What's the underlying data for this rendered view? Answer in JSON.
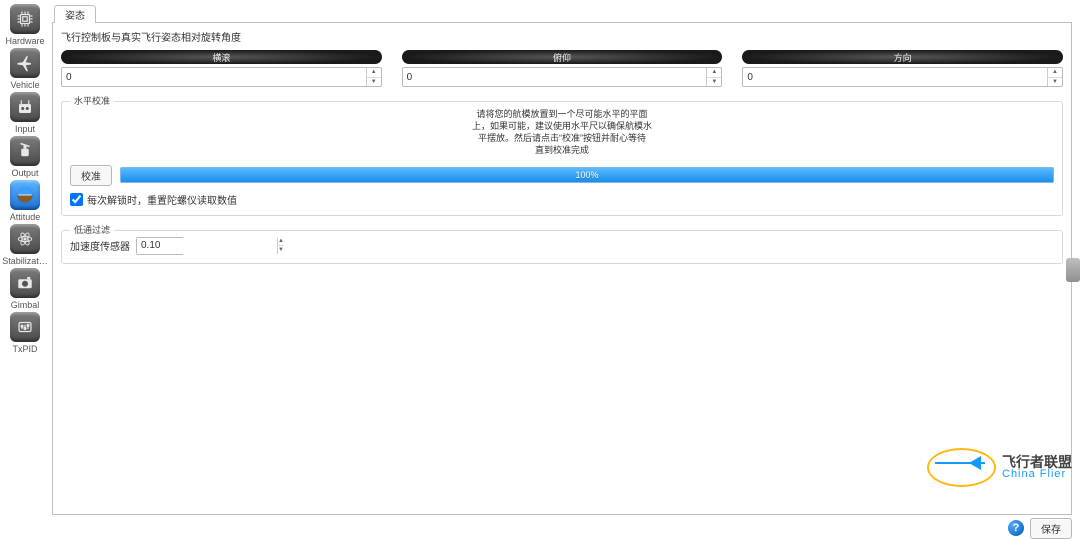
{
  "tabs": {
    "attitude": "姿态"
  },
  "sections": {
    "rotation": "飞行控制板与真实飞行姿态相对旋转角度",
    "level": "水平校准",
    "lowpass": "低通过滤"
  },
  "trims": {
    "roll": {
      "label": "横滚",
      "value": "0"
    },
    "pitch": {
      "label": "俯仰",
      "value": "0"
    },
    "yaw": {
      "label": "方向",
      "value": "0"
    }
  },
  "level_instructions": [
    "请将您的航模放置到一个尽可能水平的平面",
    "上，如果可能，建议使用水平尺以确保航模水",
    "平摆放。然后请点击“校准”按钮并耐心等待",
    "直到校准完成"
  ],
  "level": {
    "calibrate_label": "校准",
    "progress_text": "100%",
    "checkbox_label": "每次解锁时，重置陀螺仪读取数值",
    "checkbox_checked": true
  },
  "lowpass": {
    "accel_label": "加速度传感器",
    "value": "0.10"
  },
  "footer": {
    "help": "?",
    "save": "保存"
  },
  "watermark": {
    "line1": "飞行者联盟",
    "line2": "China Flier"
  },
  "sidebar": {
    "items": [
      {
        "key": "hardware",
        "label": "Hardware"
      },
      {
        "key": "vehicle",
        "label": "Vehicle"
      },
      {
        "key": "input",
        "label": "Input"
      },
      {
        "key": "output",
        "label": "Output"
      },
      {
        "key": "attitude",
        "label": "Attitude",
        "active": true
      },
      {
        "key": "stabiliz",
        "label": "Stabilizat…"
      },
      {
        "key": "gimbal",
        "label": "Gimbal"
      },
      {
        "key": "txpid",
        "label": "TxPID"
      }
    ]
  },
  "chart_data": {
    "type": "progress",
    "value": 100,
    "min": 0,
    "max": 100
  }
}
